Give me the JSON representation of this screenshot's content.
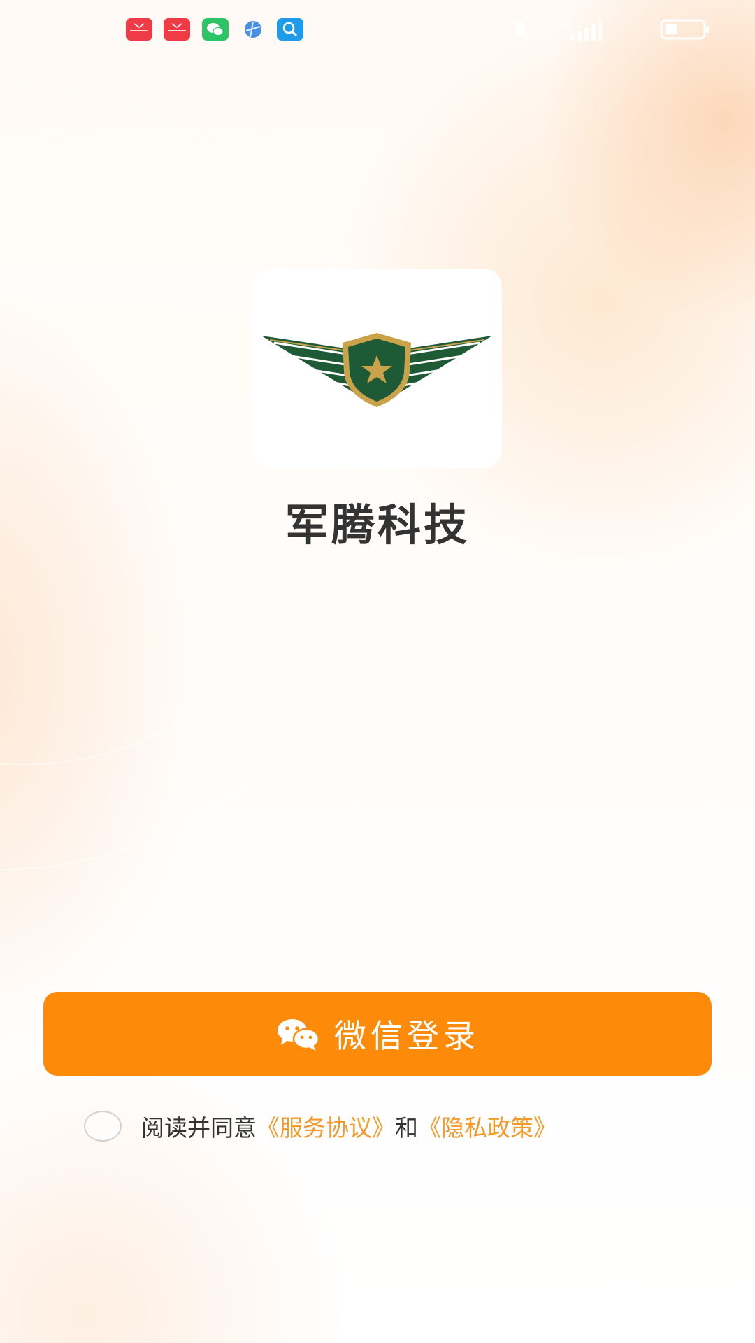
{
  "status_bar": {
    "notification_icons": [
      "mail-app-icon",
      "mail-app-icon",
      "wechat-icon",
      "browser-icon",
      "search-app-icon"
    ],
    "mute_icon": "bell-off-icon",
    "network_type": "4G",
    "signal_icon": "signal-bars-icon",
    "battery_icon": "battery-icon"
  },
  "app": {
    "logo": "shield-wings-star-logo",
    "name": "军腾科技"
  },
  "login": {
    "button_label": "微信登录",
    "button_icon": "wechat-icon"
  },
  "agreement": {
    "prefix": "阅读并同意",
    "service_link": "《服务协议》",
    "conjunction": "和",
    "privacy_link": "《隐私政策》"
  },
  "colors": {
    "accent": "#fe8a0a",
    "link": "#f29a2a",
    "logo_green": "#1e5a35",
    "logo_gold": "#c9a24a"
  }
}
